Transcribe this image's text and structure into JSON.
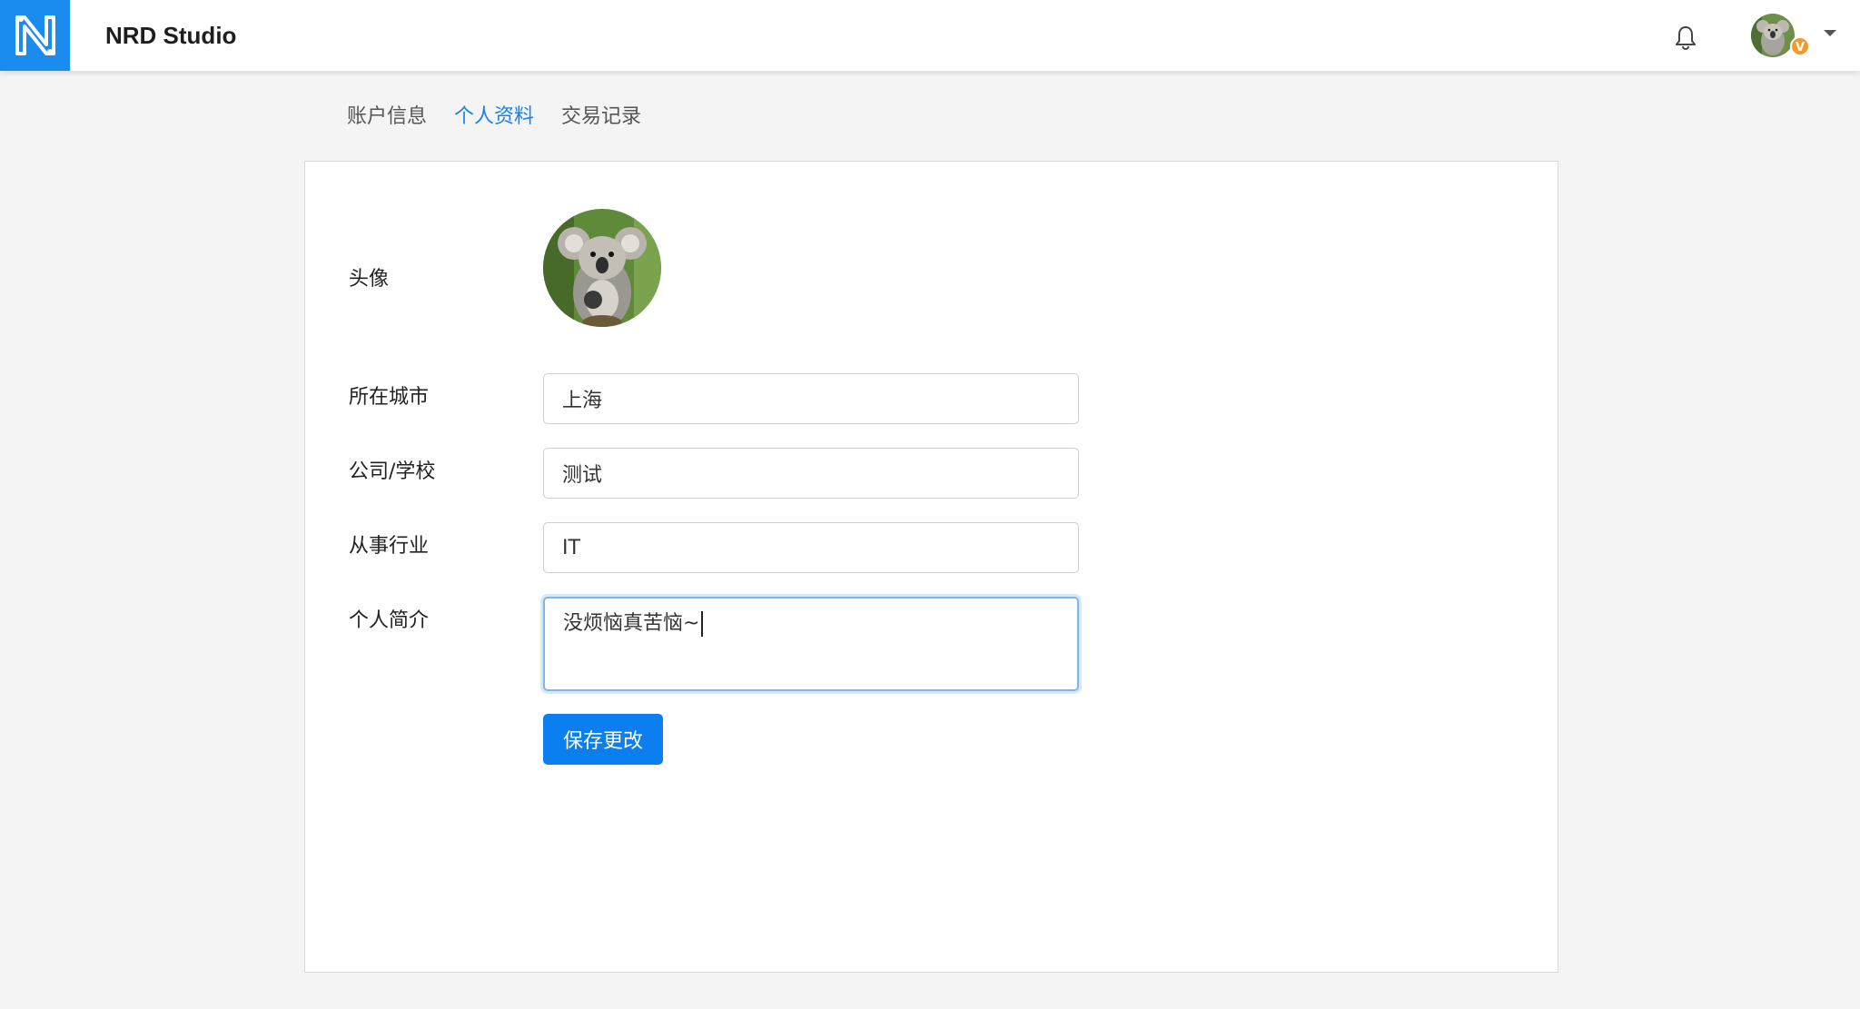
{
  "header": {
    "brand": "NRD Studio",
    "logo_letter": "N",
    "vip_badge": "V",
    "colors": {
      "logo_bg": "#1a8cf0",
      "badge": "#f39a2b"
    }
  },
  "tabs": [
    {
      "label": "账户信息",
      "active": false
    },
    {
      "label": "个人资料",
      "active": true
    },
    {
      "label": "交易记录",
      "active": false
    }
  ],
  "form": {
    "avatar_label": "头像",
    "city_label": "所在城市",
    "city_value": "上海",
    "company_label": "公司/学校",
    "company_value": "测试",
    "industry_label": "从事行业",
    "industry_value": "IT",
    "bio_label": "个人简介",
    "bio_value": "没烦恼真苦恼~",
    "save_label": "保存更改"
  },
  "colors": {
    "accent": "#0b7ef0",
    "active_tab": "#1a82e6"
  }
}
